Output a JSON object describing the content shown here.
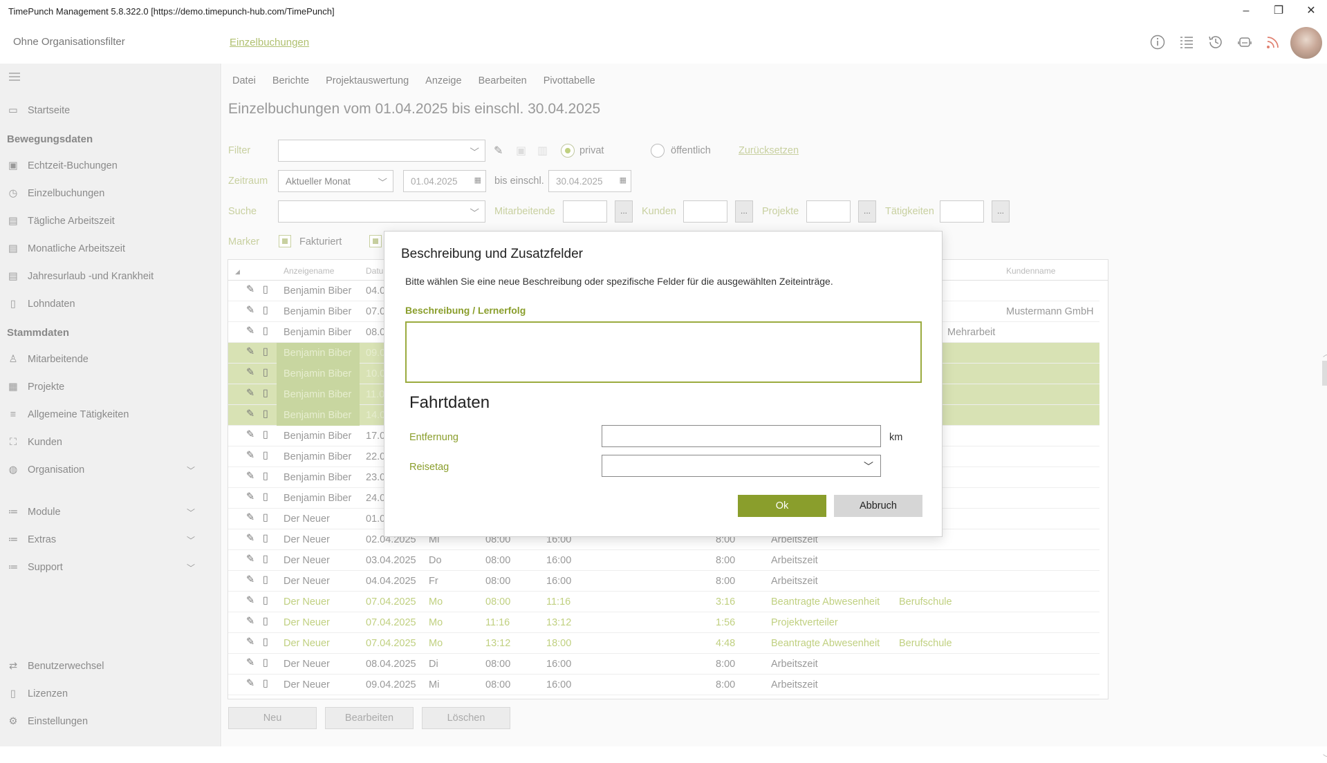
{
  "window": {
    "title": "TimePunch Management 5.8.322.0 [https://demo.timepunch-hub.com/TimePunch]",
    "minimize": "–",
    "restore": "❐",
    "close": "✕"
  },
  "header": {
    "org_filter": "Ohne Organisationsfilter",
    "breadcrumb": "Einzelbuchungen"
  },
  "sidebar": {
    "items": [
      {
        "label": "Startseite"
      },
      {
        "label": "Echtzeit-Buchungen"
      },
      {
        "label": "Einzelbuchungen"
      },
      {
        "label": "Tägliche Arbeitszeit"
      },
      {
        "label": "Monatliche Arbeitszeit"
      },
      {
        "label": "Jahresurlaub -und Krankheit"
      },
      {
        "label": "Lohndaten"
      },
      {
        "label": "Mitarbeitende"
      },
      {
        "label": "Projekte"
      },
      {
        "label": "Allgemeine Tätigkeiten"
      },
      {
        "label": "Kunden"
      },
      {
        "label": "Organisation"
      },
      {
        "label": "Module"
      },
      {
        "label": "Extras"
      },
      {
        "label": "Support"
      },
      {
        "label": "Benutzerwechsel"
      },
      {
        "label": "Lizenzen"
      },
      {
        "label": "Einstellungen"
      }
    ],
    "section_bewegungsdaten": "Bewegungsdaten",
    "section_stammdaten": "Stammdaten"
  },
  "menu": [
    "Datei",
    "Berichte",
    "Projektauswertung",
    "Anzeige",
    "Bearbeiten",
    "Pivottabelle"
  ],
  "page_title": "Einzelbuchungen vom 01.04.2025 bis einschl. 30.04.2025",
  "filters": {
    "filter_label": "Filter",
    "privat": "privat",
    "oeffentlich": "öffentlich",
    "reset": "Zurücksetzen",
    "zeitraum_label": "Zeitraum",
    "zeitraum_value": "Aktueller Monat",
    "from_date": "01.04.2025",
    "bis_label": "bis einschl.",
    "to_date": "30.04.2025",
    "suche_label": "Suche",
    "mitarbeitende": "Mitarbeitende",
    "kunden": "Kunden",
    "projekte": "Projekte",
    "taetigkeiten": "Tätigkeiten",
    "dots": "...",
    "marker_label": "Marker",
    "fakturiert": "Fakturiert"
  },
  "grid": {
    "headers": {
      "name": "Anzeigename",
      "date": "Datu",
      "customer": "Kundenname"
    },
    "rows": [
      {
        "name": "Benjamin Biber",
        "date": "04.0",
        "day": "",
        "from": "",
        "to": "",
        "dur": "",
        "type": "",
        "extra": "",
        "sel": false,
        "green": false
      },
      {
        "name": "Benjamin Biber",
        "date": "07.0",
        "day": "",
        "from": "",
        "to": "",
        "dur": "",
        "type": "",
        "extra": "Mustermann GmbH",
        "sel": false,
        "green": false
      },
      {
        "name": "Benjamin Biber",
        "date": "08.0",
        "day": "",
        "from": "",
        "to": "",
        "dur": "",
        "type": "Mehrarbeit",
        "extra": "",
        "sel": false,
        "green": false
      },
      {
        "name": "Benjamin Biber",
        "date": "09.0",
        "day": "",
        "from": "",
        "to": "",
        "dur": "",
        "type": "",
        "extra": "",
        "sel": true,
        "green": false
      },
      {
        "name": "Benjamin Biber",
        "date": "10.0",
        "day": "",
        "from": "",
        "to": "",
        "dur": "",
        "type": "",
        "extra": "",
        "sel": true,
        "green": false
      },
      {
        "name": "Benjamin Biber",
        "date": "11.0",
        "day": "",
        "from": "",
        "to": "",
        "dur": "",
        "type": "",
        "extra": "",
        "sel": true,
        "green": false
      },
      {
        "name": "Benjamin Biber",
        "date": "14.0",
        "day": "",
        "from": "",
        "to": "",
        "dur": "",
        "type": "",
        "extra": "",
        "sel": true,
        "green": false
      },
      {
        "name": "Benjamin Biber",
        "date": "17.0",
        "day": "",
        "from": "",
        "to": "",
        "dur": "",
        "type": "",
        "extra": "",
        "sel": false,
        "green": false
      },
      {
        "name": "Benjamin Biber",
        "date": "22.0",
        "day": "",
        "from": "",
        "to": "",
        "dur": "",
        "type": "",
        "extra": "",
        "sel": false,
        "green": false
      },
      {
        "name": "Benjamin Biber",
        "date": "23.0",
        "day": "",
        "from": "",
        "to": "",
        "dur": "",
        "type": "",
        "extra": "",
        "sel": false,
        "green": false
      },
      {
        "name": "Benjamin Biber",
        "date": "24.0",
        "day": "",
        "from": "",
        "to": "",
        "dur": "",
        "type": "",
        "extra": "",
        "sel": false,
        "green": false
      },
      {
        "name": "Der Neuer",
        "date": "01.0",
        "day": "",
        "from": "",
        "to": "",
        "dur": "",
        "type": "",
        "extra": "",
        "sel": false,
        "green": false
      },
      {
        "name": "Der Neuer",
        "date": "02.04.2025",
        "day": "Mi",
        "from": "08:00",
        "to": "16:00",
        "dur": "8:00",
        "type": "Arbeitszeit",
        "extra": "",
        "sel": false,
        "green": false
      },
      {
        "name": "Der Neuer",
        "date": "03.04.2025",
        "day": "Do",
        "from": "08:00",
        "to": "16:00",
        "dur": "8:00",
        "type": "Arbeitszeit",
        "extra": "",
        "sel": false,
        "green": false
      },
      {
        "name": "Der Neuer",
        "date": "04.04.2025",
        "day": "Fr",
        "from": "08:00",
        "to": "16:00",
        "dur": "8:00",
        "type": "Arbeitszeit",
        "extra": "",
        "sel": false,
        "green": false
      },
      {
        "name": "Der Neuer",
        "date": "07.04.2025",
        "day": "Mo",
        "from": "08:00",
        "to": "11:16",
        "dur": "3:16",
        "type": "Beantragte Abwesenheit",
        "extra": "Berufschule",
        "sel": false,
        "green": true
      },
      {
        "name": "Der Neuer",
        "date": "07.04.2025",
        "day": "Mo",
        "from": "11:16",
        "to": "13:12",
        "dur": "1:56",
        "type": "Projektverteiler",
        "extra": "",
        "sel": false,
        "green": true
      },
      {
        "name": "Der Neuer",
        "date": "07.04.2025",
        "day": "Mo",
        "from": "13:12",
        "to": "18:00",
        "dur": "4:48",
        "type": "Beantragte Abwesenheit",
        "extra": "Berufschule",
        "sel": false,
        "green": true
      },
      {
        "name": "Der Neuer",
        "date": "08.04.2025",
        "day": "Di",
        "from": "08:00",
        "to": "16:00",
        "dur": "8:00",
        "type": "Arbeitszeit",
        "extra": "",
        "sel": false,
        "green": false
      },
      {
        "name": "Der Neuer",
        "date": "09.04.2025",
        "day": "Mi",
        "from": "08:00",
        "to": "16:00",
        "dur": "8:00",
        "type": "Arbeitszeit",
        "extra": "",
        "sel": false,
        "green": false
      }
    ]
  },
  "bottom_buttons": {
    "neu": "Neu",
    "bearbeiten": "Bearbeiten",
    "loeschen": "Löschen"
  },
  "dialog": {
    "title": "Beschreibung und Zusatzfelder",
    "description": "Bitte wählen Sie eine neue Beschreibung oder spezifische Felder für die ausgewählten Zeiteinträge.",
    "desc_label": "Beschreibung / Lernerfolg",
    "section": "Fahrtdaten",
    "entfernung": "Entfernung",
    "km": "km",
    "reisetag": "Reisetag",
    "ok": "Ok",
    "abbruch": "Abbruch"
  },
  "colors": {
    "accent": "#8a9e2c",
    "selection": "#d8e2b4"
  }
}
